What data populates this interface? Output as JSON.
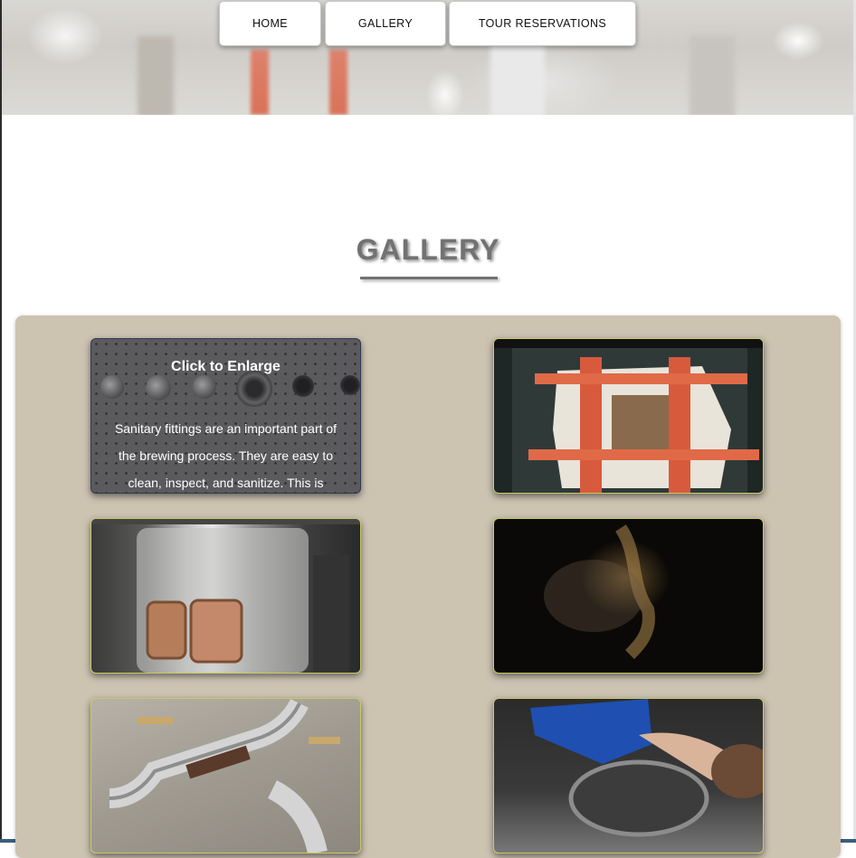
{
  "nav": {
    "items": [
      {
        "label": "HOME"
      },
      {
        "label": "GALLERY"
      },
      {
        "label": "TOUR RESERVATIONS"
      }
    ]
  },
  "page": {
    "title": "GALLERY"
  },
  "gallery": {
    "enlarge_label": "Click to Enlarge",
    "tiles": [
      {
        "caption": "Sanitary fittings are an important part of the brewing process. They are easy to clean, inspect, and sanitize. This is"
      },
      {
        "caption": ""
      },
      {
        "caption": ""
      },
      {
        "caption": ""
      },
      {
        "caption": ""
      },
      {
        "caption": ""
      }
    ]
  },
  "colors": {
    "panel": "#cdc3b1",
    "title": "#727272",
    "tile_border": "#c9c96a"
  }
}
